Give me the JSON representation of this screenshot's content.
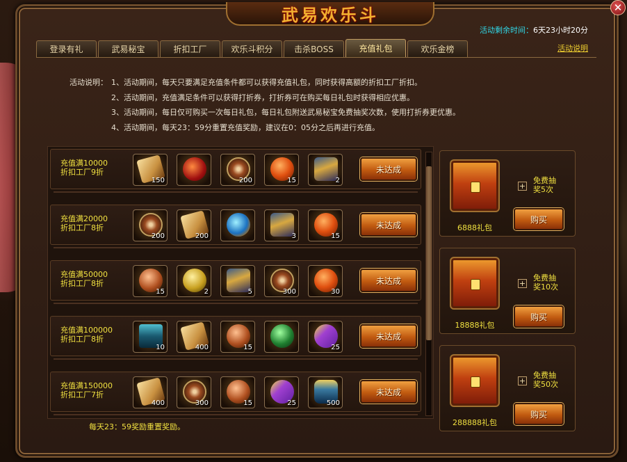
{
  "window": {
    "title": "武易欢乐斗",
    "close": "✕",
    "remaining_label": "活动剩余时间：",
    "remaining_value": "6天23小时20分"
  },
  "tabs": [
    {
      "label": "登录有礼",
      "active": false
    },
    {
      "label": "武易秘宝",
      "active": false
    },
    {
      "label": "折扣工厂",
      "active": false
    },
    {
      "label": "欢乐斗积分",
      "active": false
    },
    {
      "label": "击杀BOSS",
      "active": false
    },
    {
      "label": "充值礼包",
      "active": true
    },
    {
      "label": "欢乐金榜",
      "active": false
    }
  ],
  "help_link": "活动说明",
  "description": {
    "label": "活动说明：",
    "lines": [
      "1、活动期间，每天只要满足充值条件都可以获得充值礼包，同时获得高额的折扣工厂折扣。",
      "2、活动期间，充值满足条件可以获得打折券，打折券可在购买每日礼包时获得相应优惠。",
      "3、活动期间，每日仅可购买一次每日礼包，每日礼包附送武易秘宝免费抽奖次数，使用打折券更优惠。",
      "4、活动期间，每天23：59分重置充值奖励，建议在0：05分之后再进行充值。"
    ]
  },
  "rewards": [
    {
      "line1": "充值满10000",
      "line2": "折扣工厂9折",
      "button": "未达成",
      "items": [
        {
          "icon": "scroll",
          "qty": "150"
        },
        {
          "icon": "jewel",
          "qty": ""
        },
        {
          "icon": "compass",
          "qty": "200"
        },
        {
          "icon": "orb",
          "qty": "15"
        },
        {
          "icon": "armor",
          "qty": "2"
        }
      ]
    },
    {
      "line1": "充值满20000",
      "line2": "折扣工厂8折",
      "button": "未达成",
      "items": [
        {
          "icon": "compass",
          "qty": "200"
        },
        {
          "icon": "scroll",
          "qty": "200"
        },
        {
          "icon": "crystal",
          "qty": ""
        },
        {
          "icon": "armor",
          "qty": "3"
        },
        {
          "icon": "orb",
          "qty": "15"
        }
      ]
    },
    {
      "line1": "充值满50000",
      "line2": "折扣工厂8折",
      "button": "未达成",
      "items": [
        {
          "icon": "copper",
          "qty": "15"
        },
        {
          "icon": "gold",
          "qty": "2"
        },
        {
          "icon": "armor",
          "qty": "5"
        },
        {
          "icon": "compass",
          "qty": "300"
        },
        {
          "icon": "orb",
          "qty": "30"
        }
      ]
    },
    {
      "line1": "充值满100000",
      "line2": "折扣工厂8折",
      "button": "未达成",
      "items": [
        {
          "icon": "chest",
          "qty": "10"
        },
        {
          "icon": "scroll",
          "qty": "400"
        },
        {
          "icon": "copper",
          "qty": "15"
        },
        {
          "icon": "green",
          "qty": ""
        },
        {
          "icon": "purple",
          "qty": "25"
        }
      ]
    },
    {
      "line1": "充值满150000",
      "line2": "折扣工厂7折",
      "button": "未达成",
      "items": [
        {
          "icon": "scroll",
          "qty": "400"
        },
        {
          "icon": "compass",
          "qty": "300"
        },
        {
          "icon": "copper",
          "qty": "15"
        },
        {
          "icon": "purple",
          "qty": "25"
        },
        {
          "icon": "vial",
          "qty": "500"
        }
      ]
    }
  ],
  "reset_note": "每天23：59奖励重置奖励。",
  "packs": [
    {
      "name": "6888礼包",
      "free_line1": "免费抽",
      "free_line2": "奖5次",
      "plus": "+",
      "button": "购买"
    },
    {
      "name": "18888礼包",
      "free_line1": "免费抽",
      "free_line2": "奖10次",
      "plus": "+",
      "button": "购买"
    },
    {
      "name": "288888礼包",
      "free_line1": "免费抽",
      "free_line2": "奖50次",
      "plus": "+",
      "button": "购买"
    }
  ]
}
